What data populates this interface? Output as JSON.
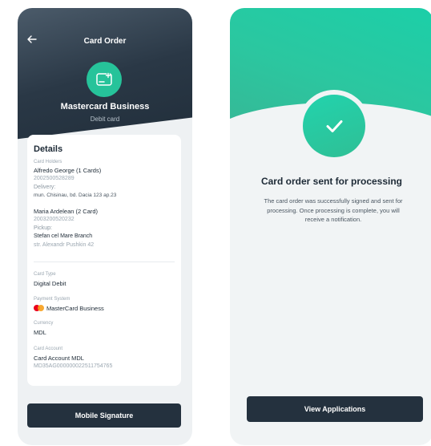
{
  "order_screen": {
    "title": "Card Order",
    "product_name": "Mastercard Business",
    "product_subtitle": "Debit card",
    "details_title": "Details",
    "card_holders_label": "Card Holders",
    "holders": [
      {
        "name": "Alfredo George (1 Cards)",
        "id": "2002500528289",
        "method_label": "Delivery:",
        "address_line1": "mun. Chisinau, bd. Dacia 123 ap.23",
        "address_line2": ""
      },
      {
        "name": "Maria Ardelean (2 Card)",
        "id": "2003200520232",
        "method_label": "Pickup:",
        "address_line1": "Stefan cel Mare Branch",
        "address_line2": "str. Alexandr Pushkin 42"
      }
    ],
    "card_type_label": "Card Type",
    "card_type_value": "Digital Debit",
    "payment_system_label": "Payment System",
    "payment_system_value": "MasterCard Business",
    "currency_label": "Currency",
    "currency_value": "MDL",
    "card_account_label": "Card Account",
    "card_account_value": "Card Account MDL",
    "card_account_iban": "MD35AG000000022511754765",
    "action_button": "Mobile Signature"
  },
  "success_screen": {
    "title": "Card order sent for processing",
    "message": "The card order was successfully signed and sent for processing. Once processing is complete, you will receive a notification.",
    "action_button": "View Applications"
  },
  "icons": {
    "back": "arrow-left-icon",
    "card": "card-add-icon",
    "success": "check-icon",
    "mastercard": "mastercard-logo"
  },
  "colors": {
    "accent": "#26c39a",
    "dark": "#24313e",
    "mc_red": "#eb001b",
    "mc_orange": "#f79e1b"
  }
}
